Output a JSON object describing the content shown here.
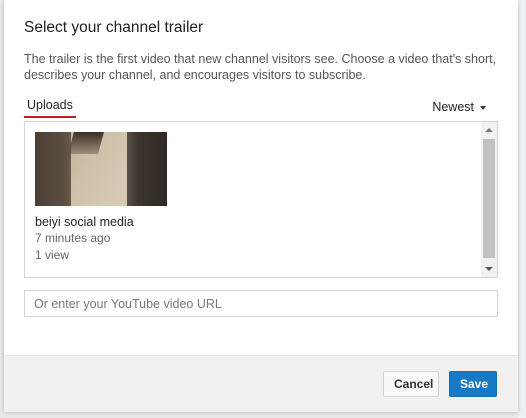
{
  "dialog": {
    "title": "Select your channel trailer",
    "description": "The trailer is the first video that new channel visitors see. Choose a video that's short, describes your channel, and encourages visitors to subscribe.",
    "tab_label": "Uploads",
    "sort_label": "Newest",
    "sort_icon": "caret-down-icon"
  },
  "videos": [
    {
      "title": "beiyi social media",
      "age": "7 minutes ago",
      "views": "1 view"
    }
  ],
  "url_input": {
    "placeholder": "Or enter your YouTube video URL",
    "value": ""
  },
  "buttons": {
    "cancel_label": "Cancel",
    "save_label": "Save"
  },
  "colors": {
    "accent_blue": "#167ac6",
    "tab_underline": "#cc181e"
  }
}
